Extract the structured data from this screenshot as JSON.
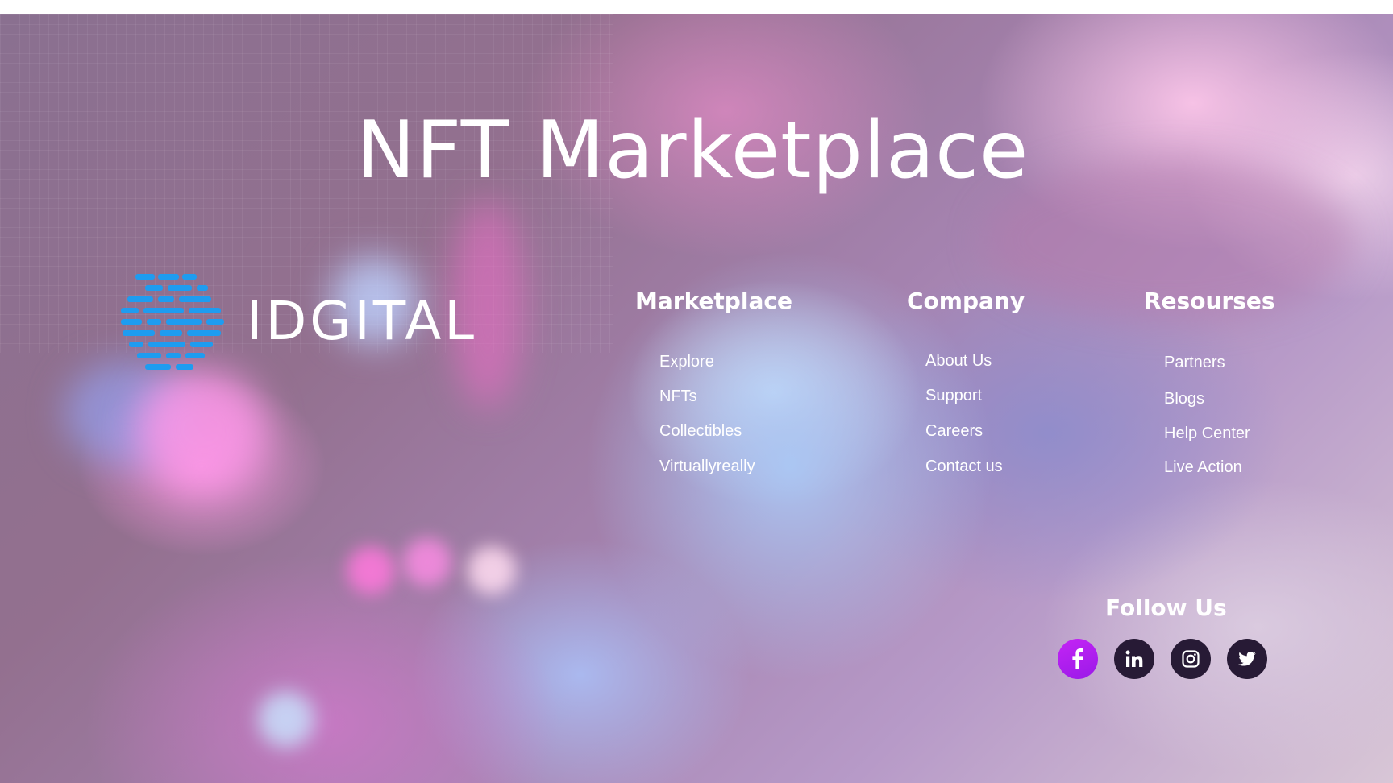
{
  "hero": {
    "title": "NFT Marketplace"
  },
  "brand": {
    "name": "IDGITAL",
    "mark_colors": [
      "#1e9cf0",
      "#0a6fd6"
    ]
  },
  "columns": {
    "marketplace": {
      "heading": "Marketplace",
      "links": [
        "Explore",
        "NFTs",
        "Collectibles",
        "Virtuallyreally"
      ]
    },
    "company": {
      "heading": "Company",
      "links": [
        "About Us",
        "Support",
        "Careers",
        "Contact us"
      ]
    },
    "resources": {
      "heading": "Resourses",
      "links": [
        "Partners",
        "Blogs",
        "Help Center",
        "Live Action"
      ]
    }
  },
  "follow": {
    "heading": "Follow Us",
    "icons": [
      "facebook-icon",
      "linkedin-icon",
      "instagram-icon",
      "twitter-icon"
    ],
    "active_color": "#b31ff0",
    "icon_bg": "#271a35"
  }
}
